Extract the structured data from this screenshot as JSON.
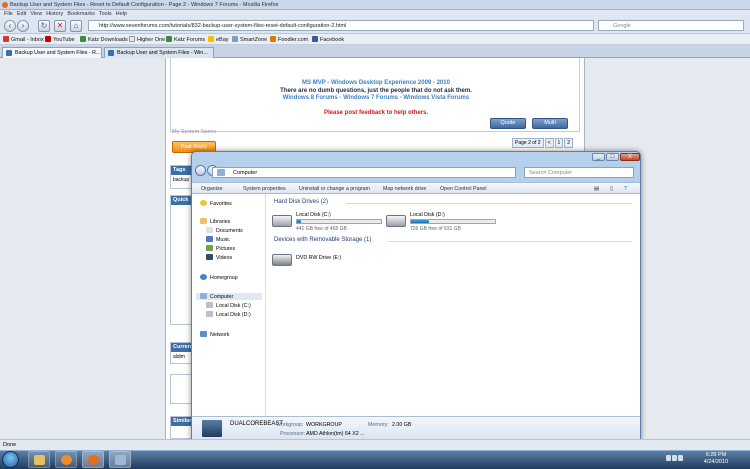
{
  "browser": {
    "title": "Backup User and System Files - Reset to Default Configuration - Page 2 - Windows 7 Forums - Mozilla Firefox",
    "menu": [
      "File",
      "Edit",
      "View",
      "History",
      "Bookmarks",
      "Tools",
      "Help"
    ],
    "url": "http://www.sevenforums.com/tutorials/832-backup-user-system-files-reset-default-configuration-2.html",
    "search_placeholder": "Google",
    "bookmarks": [
      "Gmail - Inbox",
      "YouTube",
      "Katz Downloads",
      "Higher One",
      "Katz Forums",
      "eBay",
      "SmartZone",
      "Foodler.com",
      "Facebook"
    ],
    "tabs": [
      "Backup User and System Files - R...",
      "Backup User and System Files - Win..."
    ],
    "status": "Done"
  },
  "forum": {
    "mvp": "MS MVP - Windows Desktop Experience 2009 - 2010",
    "dumb": "There are no dumb questions, just the people that do not ask them.",
    "links": [
      "Windows 8 Forums",
      "Windows 7 Forums",
      "Windows Vista Forums"
    ],
    "link_sep": " - ",
    "feedback": "Please post feedback to help others.",
    "quote": "Quote",
    "multi": "Multi",
    "specs": "My System Specs",
    "post_reply": "Post Reply",
    "pager": [
      "Page 2 of 2",
      "<",
      "1",
      "2"
    ],
    "side_tags": "Tags",
    "side_tags_item": "backup",
    "side_quick": "Quick",
    "side_current": "Current",
    "side_current_item": "aldim",
    "side_similar": "Similar"
  },
  "explorer": {
    "controls": [
      "_",
      "□",
      "X"
    ],
    "breadcrumb": "Computer",
    "search_placeholder": "Search Computer",
    "toolbar": [
      "Organize",
      "System properties",
      "Uninstall or change a program",
      "Map network drive",
      "Open Control Panel"
    ],
    "nav": {
      "favorites": "Favorites",
      "libraries": "Libraries",
      "lib_items": [
        "Documents",
        "Music",
        "Pictures",
        "Videos"
      ],
      "homegroup": "Homegroup",
      "computer": "Computer",
      "computer_items": [
        "Local Disk (C:)",
        "Local Disk (D:)"
      ],
      "network": "Network"
    },
    "groups": {
      "hdd": "Hard Disk Drives (2)",
      "removable": "Devices with Removable Storage (1)"
    },
    "drives": [
      {
        "name": "Local Disk (C:)",
        "free": "441 GB free of 465 GB",
        "used_fraction": 0.05
      },
      {
        "name": "Local Disk (D:)",
        "free": "726 GB free of 931 GB",
        "used_fraction": 0.22
      }
    ],
    "dvd": "DVD RW Drive (E:)",
    "details": {
      "name": "DUALCOREBEAST",
      "workgroup_label": "Workgroup:",
      "workgroup": "WORKGROUP",
      "memory_label": "Memory:",
      "memory": "2.00 GB",
      "processor_label": "Processor:",
      "processor": "AMD Athlon(tm) 64 X2 ..."
    }
  },
  "taskbar": {
    "time": "6:28 PM",
    "date": "4/24/2010"
  }
}
